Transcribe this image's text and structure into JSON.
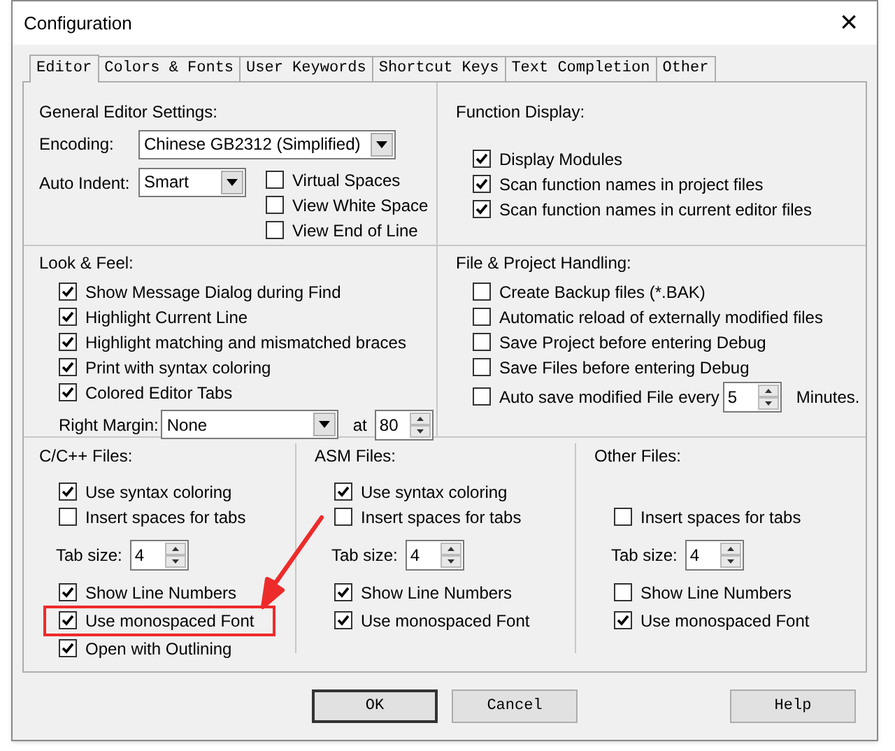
{
  "window": {
    "title": "Configuration",
    "close": "×"
  },
  "tabs": [
    {
      "label": "Editor",
      "selected": true
    },
    {
      "label": "Colors & Fonts",
      "selected": false
    },
    {
      "label": "User Keywords",
      "selected": false
    },
    {
      "label": "Shortcut Keys",
      "selected": false
    },
    {
      "label": "Text Completion",
      "selected": false
    },
    {
      "label": "Other",
      "selected": false
    }
  ],
  "general": {
    "title": "General Editor Settings:",
    "encoding_label": "Encoding:",
    "encoding": "Chinese GB2312 (Simplified)",
    "indent_label": "Auto Indent:",
    "indent": "Smart",
    "options": [
      {
        "label": "Virtual Spaces",
        "checked": false
      },
      {
        "label": "View White Space",
        "checked": false
      },
      {
        "label": "View End of Line",
        "checked": false
      }
    ]
  },
  "function_display": {
    "title": "Function Display:",
    "options": [
      {
        "label": "Display Modules",
        "checked": true
      },
      {
        "label": "Scan function names in project files",
        "checked": true
      },
      {
        "label": "Scan function names in current editor files",
        "checked": true
      }
    ]
  },
  "look_feel": {
    "title": "Look & Feel:",
    "options": [
      {
        "label": "Show Message Dialog during Find",
        "checked": true
      },
      {
        "label": "Highlight Current Line",
        "checked": true
      },
      {
        "label": "Highlight matching and mismatched braces",
        "checked": true
      },
      {
        "label": "Print with syntax coloring",
        "checked": true
      },
      {
        "label": "Colored Editor Tabs",
        "checked": true
      }
    ],
    "margin_label": "Right Margin:",
    "margin": "None",
    "at_label": "at",
    "at": "80"
  },
  "file_handling": {
    "title": "File & Project Handling:",
    "options": [
      {
        "label": "Create Backup files (*.BAK)",
        "checked": false
      },
      {
        "label": "Automatic reload of externally modified files",
        "checked": false
      },
      {
        "label": "Save Project before entering Debug",
        "checked": false
      },
      {
        "label": "Save Files before entering Debug",
        "checked": false
      }
    ],
    "autosave": {
      "label": "Auto save modified File every",
      "checked": false,
      "value": "5",
      "unit": "Minutes."
    }
  },
  "file_types": [
    {
      "title": "C/C++ Files:",
      "items": [
        {
          "kind": "checkbox",
          "label": "Use syntax coloring",
          "checked": true,
          "highlighted": false
        },
        {
          "kind": "checkbox",
          "label": "Insert spaces for tabs",
          "checked": false,
          "highlighted": false
        },
        {
          "kind": "tabsize",
          "label": "Tab size:",
          "value": "4"
        },
        {
          "kind": "checkbox",
          "label": "Show Line Numbers",
          "checked": true,
          "highlighted": false
        },
        {
          "kind": "checkbox",
          "label": "Use monospaced Font",
          "checked": true,
          "highlighted": true
        },
        {
          "kind": "checkbox",
          "label": "Open with Outlining",
          "checked": true,
          "highlighted": false
        }
      ]
    },
    {
      "title": "ASM Files:",
      "items": [
        {
          "kind": "checkbox",
          "label": "Use syntax coloring",
          "checked": true,
          "highlighted": false
        },
        {
          "kind": "checkbox",
          "label": "Insert spaces for tabs",
          "checked": false,
          "highlighted": false
        },
        {
          "kind": "tabsize",
          "label": "Tab size:",
          "value": "4"
        },
        {
          "kind": "checkbox",
          "label": "Show Line Numbers",
          "checked": true,
          "highlighted": false
        },
        {
          "kind": "checkbox",
          "label": "Use monospaced Font",
          "checked": true,
          "highlighted": false
        }
      ]
    },
    {
      "title": "Other Files:",
      "items": [
        {
          "kind": "blank"
        },
        {
          "kind": "checkbox",
          "label": "Insert spaces for tabs",
          "checked": false,
          "highlighted": false
        },
        {
          "kind": "tabsize",
          "label": "Tab size:",
          "value": "4"
        },
        {
          "kind": "checkbox",
          "label": "Show Line Numbers",
          "checked": false,
          "highlighted": false
        },
        {
          "kind": "checkbox",
          "label": "Use monospaced Font",
          "checked": true,
          "highlighted": false
        }
      ]
    }
  ],
  "buttons": [
    {
      "label": "OK"
    },
    {
      "label": "Cancel"
    },
    {
      "label": "Help"
    }
  ]
}
